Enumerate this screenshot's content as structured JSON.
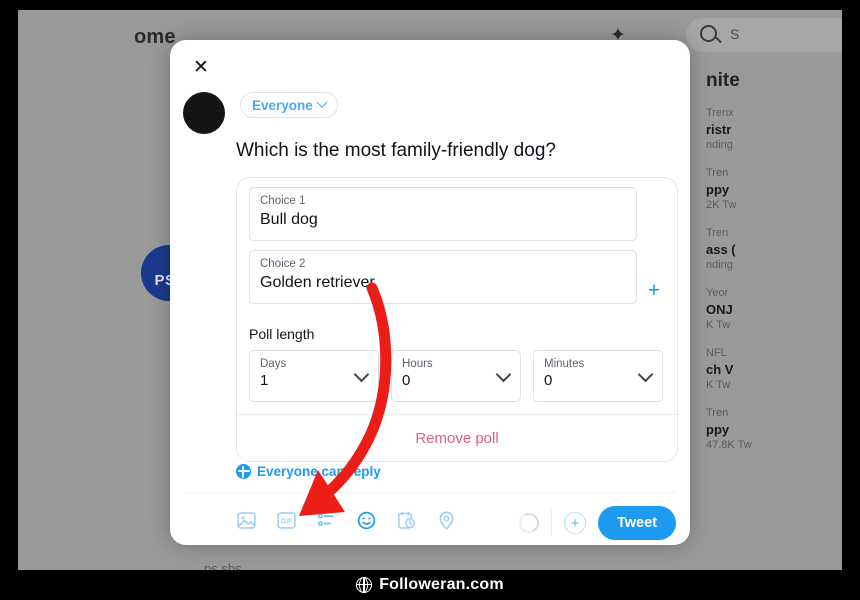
{
  "background": {
    "home_label": "ome",
    "search_placeholder": "S",
    "sparkle_icon": "sparkle-icon",
    "logo_text": "PS.A",
    "bottom_label": "ps.sbs",
    "trends_title": "nite",
    "trends": [
      {
        "category": "Trenx",
        "name": "ristr",
        "count": "nding"
      },
      {
        "category": "Tren",
        "name": "ppy",
        "count": "2K Tw"
      },
      {
        "category": "Tren",
        "name": "ass (",
        "count": "nding"
      },
      {
        "category": "Yeor",
        "name": "ONJ",
        "count": "K Tw"
      },
      {
        "category": "NFL",
        "name": "ch V",
        "count": "K Tw"
      },
      {
        "category": "Tren",
        "name": "ppy",
        "count": "47.8K Tw"
      }
    ]
  },
  "modal": {
    "close_label": "✕",
    "audience": {
      "label": "Everyone",
      "chevron": "chevron-down-icon"
    },
    "question": "Which is the most family-friendly dog?",
    "poll": {
      "choices": [
        {
          "label": "Choice 1",
          "value": "Bull dog"
        },
        {
          "label": "Choice 2",
          "value": "Golden retriever"
        }
      ],
      "add_choice_label": "+",
      "length_label": "Poll length",
      "length_fields": [
        {
          "label": "Days",
          "value": "1"
        },
        {
          "label": "Hours",
          "value": "0"
        },
        {
          "label": "Minutes",
          "value": "0"
        }
      ],
      "remove_label": "Remove poll"
    },
    "reply_setting": {
      "icon": "globe-icon",
      "text": "Everyone can reply"
    },
    "toolbar": {
      "icons": [
        "image-icon",
        "gif-icon",
        "poll-icon",
        "emoji-icon",
        "schedule-icon",
        "location-icon"
      ],
      "progress_ring": "progress-ring",
      "add_post_label": "+",
      "tweet_label": "Tweet"
    }
  },
  "annotation": {
    "arrow_color": "#ec1c16",
    "arrow_points_to": "poll-icon"
  },
  "watermark": {
    "icon": "globe-icon",
    "text": "Followeran.com"
  },
  "colors": {
    "accent_blue": "#1d9bf0",
    "pill_blue": "#4aa8ef",
    "remove_red": "#e0607a",
    "arrow_red": "#ec1c16",
    "page_bg": "#9a9a9a",
    "frame": "#000000"
  }
}
